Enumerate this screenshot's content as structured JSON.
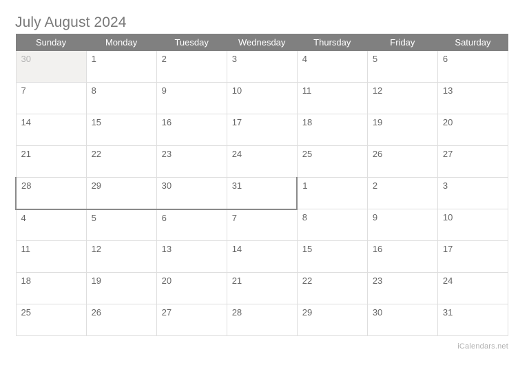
{
  "calendar": {
    "title": "July August 2024",
    "weekday_headers": [
      "Sunday",
      "Monday",
      "Tuesday",
      "Wednesday",
      "Thursday",
      "Friday",
      "Saturday"
    ],
    "weeks": [
      [
        {
          "day": "30",
          "month": "june",
          "other_month": true
        },
        {
          "day": "1",
          "month": "july",
          "other_month": false
        },
        {
          "day": "2",
          "month": "july",
          "other_month": false
        },
        {
          "day": "3",
          "month": "july",
          "other_month": false
        },
        {
          "day": "4",
          "month": "july",
          "other_month": false
        },
        {
          "day": "5",
          "month": "july",
          "other_month": false
        },
        {
          "day": "6",
          "month": "july",
          "other_month": false
        }
      ],
      [
        {
          "day": "7",
          "month": "july",
          "other_month": false
        },
        {
          "day": "8",
          "month": "july",
          "other_month": false
        },
        {
          "day": "9",
          "month": "july",
          "other_month": false
        },
        {
          "day": "10",
          "month": "july",
          "other_month": false
        },
        {
          "day": "11",
          "month": "july",
          "other_month": false
        },
        {
          "day": "12",
          "month": "july",
          "other_month": false
        },
        {
          "day": "13",
          "month": "july",
          "other_month": false
        }
      ],
      [
        {
          "day": "14",
          "month": "july",
          "other_month": false
        },
        {
          "day": "15",
          "month": "july",
          "other_month": false
        },
        {
          "day": "16",
          "month": "july",
          "other_month": false
        },
        {
          "day": "17",
          "month": "july",
          "other_month": false
        },
        {
          "day": "18",
          "month": "july",
          "other_month": false
        },
        {
          "day": "19",
          "month": "july",
          "other_month": false
        },
        {
          "day": "20",
          "month": "july",
          "other_month": false
        }
      ],
      [
        {
          "day": "21",
          "month": "july",
          "other_month": false
        },
        {
          "day": "22",
          "month": "july",
          "other_month": false
        },
        {
          "day": "23",
          "month": "july",
          "other_month": false
        },
        {
          "day": "24",
          "month": "july",
          "other_month": false
        },
        {
          "day": "25",
          "month": "july",
          "other_month": false
        },
        {
          "day": "26",
          "month": "july",
          "other_month": false
        },
        {
          "day": "27",
          "month": "july",
          "other_month": false
        }
      ],
      [
        {
          "day": "28",
          "month": "july",
          "other_month": false
        },
        {
          "day": "29",
          "month": "july",
          "other_month": false
        },
        {
          "day": "30",
          "month": "july",
          "other_month": false
        },
        {
          "day": "31",
          "month": "july",
          "other_month": false
        },
        {
          "day": "1",
          "month": "august",
          "other_month": false
        },
        {
          "day": "2",
          "month": "august",
          "other_month": false
        },
        {
          "day": "3",
          "month": "august",
          "other_month": false
        }
      ],
      [
        {
          "day": "4",
          "month": "august",
          "other_month": false
        },
        {
          "day": "5",
          "month": "august",
          "other_month": false
        },
        {
          "day": "6",
          "month": "august",
          "other_month": false
        },
        {
          "day": "7",
          "month": "august",
          "other_month": false
        },
        {
          "day": "8",
          "month": "august",
          "other_month": false
        },
        {
          "day": "9",
          "month": "august",
          "other_month": false
        },
        {
          "day": "10",
          "month": "august",
          "other_month": false
        }
      ],
      [
        {
          "day": "11",
          "month": "august",
          "other_month": false
        },
        {
          "day": "12",
          "month": "august",
          "other_month": false
        },
        {
          "day": "13",
          "month": "august",
          "other_month": false
        },
        {
          "day": "14",
          "month": "august",
          "other_month": false
        },
        {
          "day": "15",
          "month": "august",
          "other_month": false
        },
        {
          "day": "16",
          "month": "august",
          "other_month": false
        },
        {
          "day": "17",
          "month": "august",
          "other_month": false
        }
      ],
      [
        {
          "day": "18",
          "month": "august",
          "other_month": false
        },
        {
          "day": "19",
          "month": "august",
          "other_month": false
        },
        {
          "day": "20",
          "month": "august",
          "other_month": false
        },
        {
          "day": "21",
          "month": "august",
          "other_month": false
        },
        {
          "day": "22",
          "month": "august",
          "other_month": false
        },
        {
          "day": "23",
          "month": "august",
          "other_month": false
        },
        {
          "day": "24",
          "month": "august",
          "other_month": false
        }
      ],
      [
        {
          "day": "25",
          "month": "august",
          "other_month": false
        },
        {
          "day": "26",
          "month": "august",
          "other_month": false
        },
        {
          "day": "27",
          "month": "august",
          "other_month": false
        },
        {
          "day": "28",
          "month": "august",
          "other_month": false
        },
        {
          "day": "29",
          "month": "august",
          "other_month": false
        },
        {
          "day": "30",
          "month": "august",
          "other_month": false
        },
        {
          "day": "31",
          "month": "august",
          "other_month": false
        }
      ]
    ],
    "footer_credit": "iCalendars.net",
    "colors": {
      "header_background": "#808080",
      "header_text": "#ffffff",
      "title_text": "#7a7a7a",
      "day_text": "#666666",
      "other_month_background": "#f2f1ef",
      "other_month_text": "#b4b4b4",
      "grid_line": "#dedede",
      "month_outline": "#8a8a8a",
      "footer_text": "#b0b0b0"
    }
  }
}
